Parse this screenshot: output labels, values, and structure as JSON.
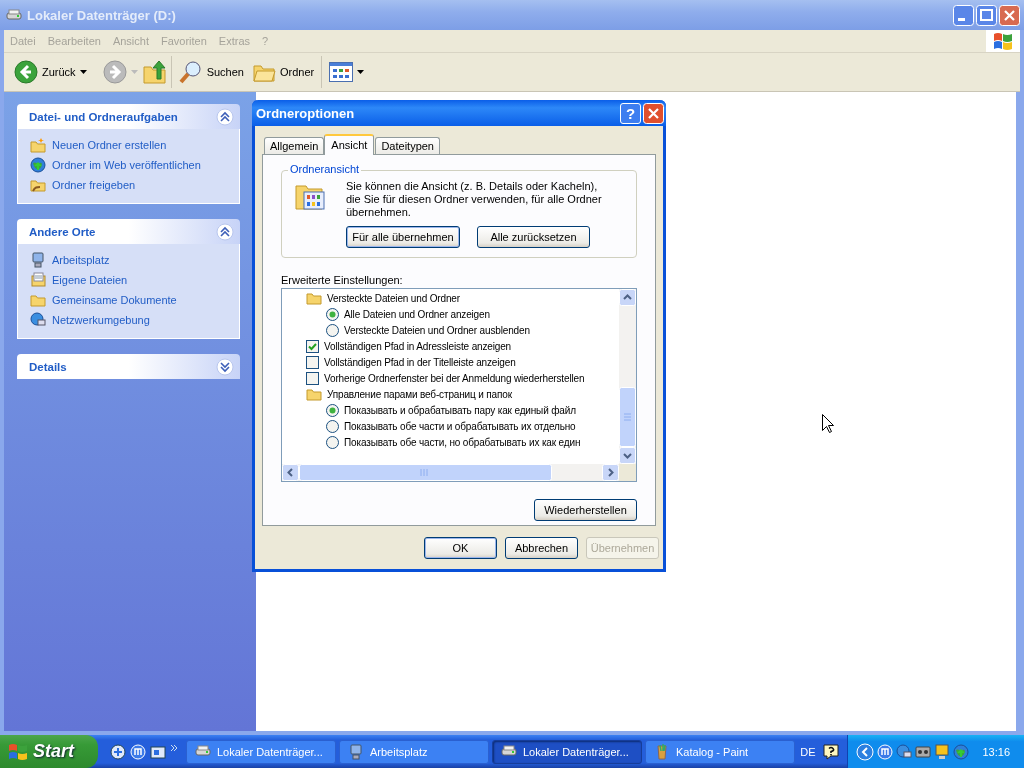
{
  "window": {
    "title": "Lokaler Datenträger (D:)"
  },
  "menu": [
    "Datei",
    "Bearbeiten",
    "Ansicht",
    "Favoriten",
    "Extras",
    "?"
  ],
  "toolbar": {
    "back": "Zurück",
    "search": "Suchen",
    "folders": "Ordner"
  },
  "sidebar": {
    "panels": [
      {
        "title": "Datei- und Ordneraufgaben",
        "expanded": true,
        "items": [
          "Neuen Ordner erstellen",
          "Ordner im Web veröffentlichen",
          "Ordner freigeben"
        ]
      },
      {
        "title": "Andere Orte",
        "expanded": true,
        "items": [
          "Arbeitsplatz",
          "Eigene Dateien",
          "Gemeinsame Dokumente",
          "Netzwerkumgebung"
        ]
      },
      {
        "title": "Details",
        "expanded": false
      }
    ]
  },
  "dialog": {
    "title": "Ordneroptionen",
    "help": "?",
    "tabs": [
      {
        "label": "Allgemein",
        "selected": false
      },
      {
        "label": "Ansicht",
        "selected": true
      },
      {
        "label": "Dateitypen",
        "selected": false
      }
    ],
    "group": {
      "title": "Ordneransicht",
      "text": "Sie können die Ansicht (z. B. Details oder Kacheln), die Sie für diesen Ordner verwenden, für alle Ordner übernehmen.",
      "buttons": [
        "Für alle übernehmen",
        "Alle zurücksetzen"
      ]
    },
    "advanced_label": "Erweiterte Einstellungen:",
    "settings": [
      {
        "kind": "folder",
        "label": "Versteckte Dateien und Ordner",
        "children": [
          {
            "kind": "radio",
            "label": "Alle Dateien und Ordner anzeigen",
            "selected": true
          },
          {
            "kind": "radio",
            "label": "Versteckte Dateien und Ordner ausblenden",
            "selected": false
          }
        ]
      },
      {
        "kind": "checkbox",
        "label": "Vollständigen Pfad in Adressleiste anzeigen",
        "checked": true
      },
      {
        "kind": "checkbox",
        "label": "Vollständigen Pfad in der Titelleiste anzeigen",
        "checked": false
      },
      {
        "kind": "checkbox",
        "label": "Vorherige Ordnerfenster bei der Anmeldung wiederherstellen",
        "checked": false
      },
      {
        "kind": "folder",
        "label": "Управление парами веб-страниц и папок",
        "children": [
          {
            "kind": "radio",
            "label": "Показывать и обрабатывать пару как единый файл",
            "selected": true
          },
          {
            "kind": "radio",
            "label": "Показывать обе части и обрабатывать их отдельно",
            "selected": false
          },
          {
            "kind": "radio",
            "label": "Показывать обе части, но обрабатывать их как един",
            "selected": false
          }
        ]
      }
    ],
    "restore_button": "Wiederherstellen",
    "buttons": [
      {
        "label": "OK",
        "disabled": false
      },
      {
        "label": "Abbrechen",
        "disabled": false
      },
      {
        "label": "Übernehmen",
        "disabled": true
      }
    ]
  },
  "taskbar": {
    "start": "Start",
    "tasks": [
      {
        "label": "Lokaler Datenträger...",
        "selected": false
      },
      {
        "label": "Arbeitsplatz",
        "selected": false
      },
      {
        "label": "Lokaler Datenträger...",
        "selected": true
      },
      {
        "label": "Katalog - Paint",
        "selected": false
      }
    ],
    "language": "DE",
    "clock": "13:16"
  }
}
